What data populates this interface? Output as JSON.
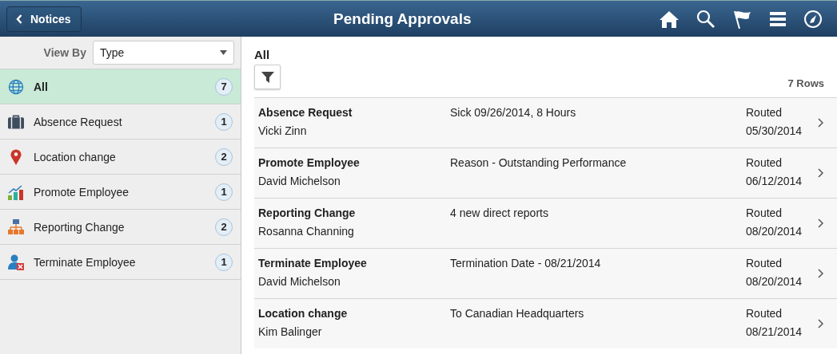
{
  "header": {
    "back_button": "Notices",
    "title": "Pending Approvals"
  },
  "sidebar": {
    "view_by": {
      "label": "View By",
      "value": "Type"
    },
    "items": [
      {
        "label": "All",
        "count": "7",
        "selected": true
      },
      {
        "label": "Absence Request",
        "count": "1",
        "selected": false
      },
      {
        "label": "Location change",
        "count": "2",
        "selected": false
      },
      {
        "label": "Promote Employee",
        "count": "1",
        "selected": false
      },
      {
        "label": "Reporting Change",
        "count": "2",
        "selected": false
      },
      {
        "label": "Terminate Employee",
        "count": "1",
        "selected": false
      }
    ]
  },
  "content": {
    "title": "All",
    "row_count": "7 Rows",
    "rows": [
      {
        "type": "Absence Request",
        "person": "Vicki Zinn",
        "detail": "Sick 09/26/2014, 8 Hours",
        "status": "Routed",
        "date": "05/30/2014"
      },
      {
        "type": "Promote Employee",
        "person": "David Michelson",
        "detail": "Reason - Outstanding Performance",
        "status": "Routed",
        "date": "06/12/2014"
      },
      {
        "type": "Reporting Change",
        "person": "Rosanna Channing",
        "detail": "4 new direct reports",
        "status": "Routed",
        "date": "08/20/2014"
      },
      {
        "type": "Terminate Employee",
        "person": "David Michelson",
        "detail": "Termination Date - 08/21/2014",
        "status": "Routed",
        "date": "08/20/2014"
      },
      {
        "type": "Location change",
        "person": "Kim Balinger",
        "detail": "To Canadian Headquarters",
        "status": "Routed",
        "date": "08/21/2014"
      }
    ]
  }
}
